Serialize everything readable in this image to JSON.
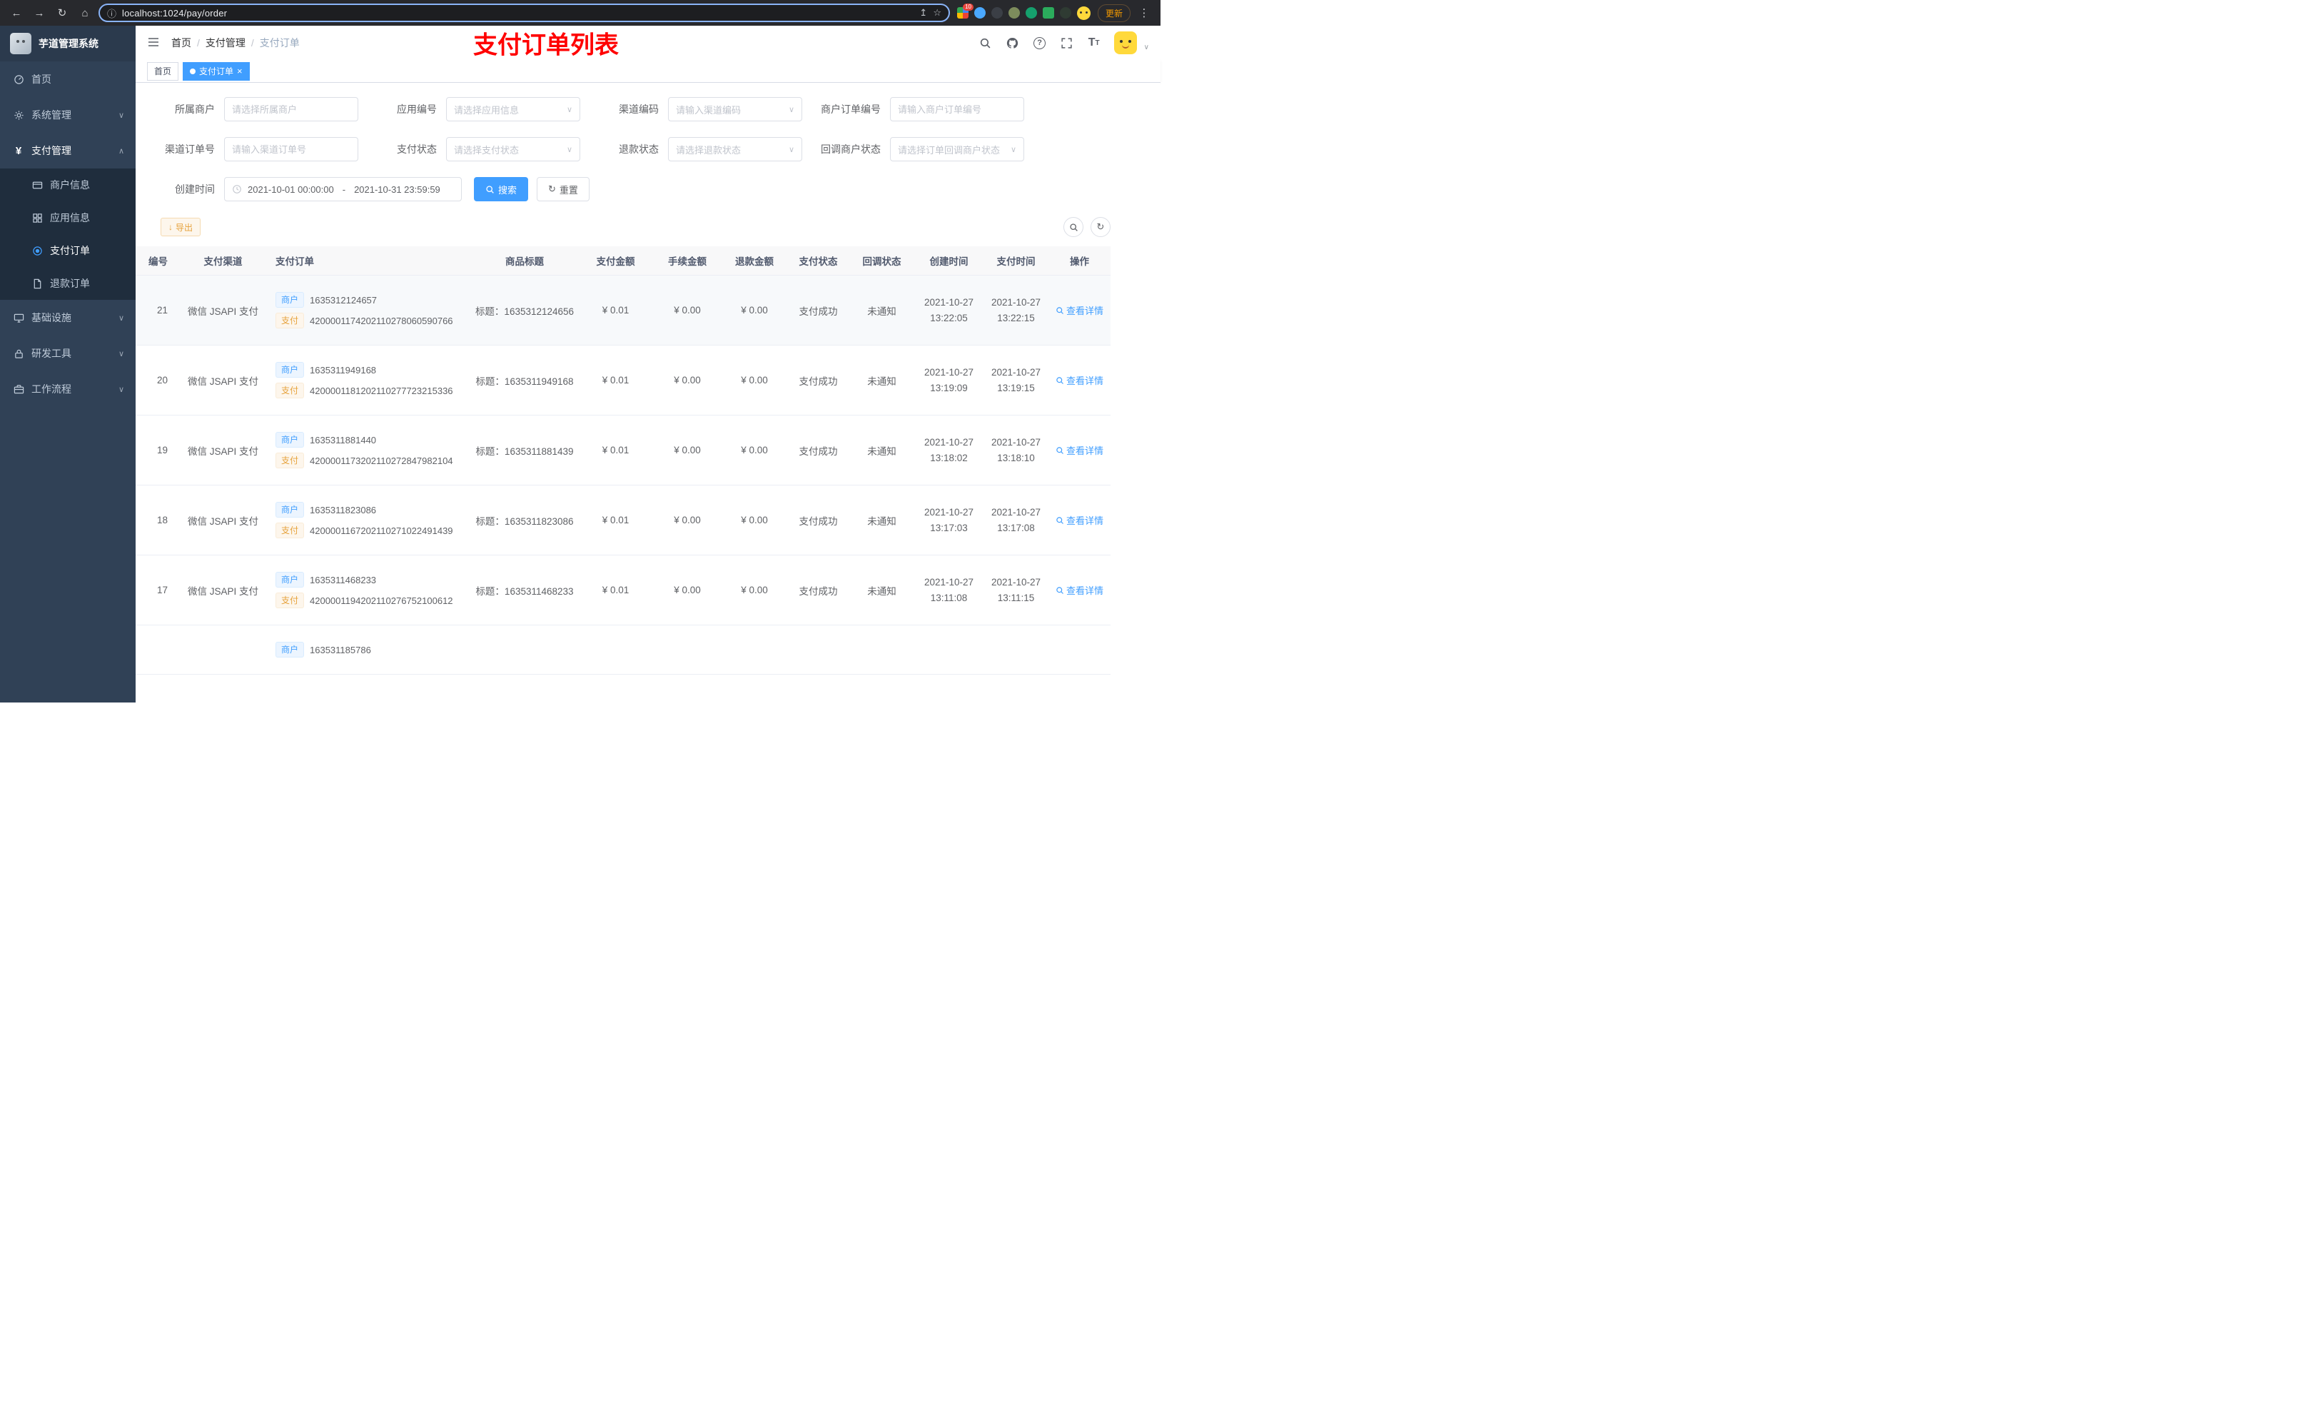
{
  "theme": {
    "accent": "#409eff",
    "annotation_red": "#ff0000",
    "warning": "#e6a23c",
    "sidebar_bg": "#304156"
  },
  "ui_icons": {
    "caret_down": "∨",
    "caret_up": "∧",
    "refresh": "↻",
    "download": "↓",
    "close": "×",
    "question": "?",
    "fontsize": "T",
    "avatar_caret": "∨"
  },
  "browser": {
    "url": "localhost:1024/pay/order",
    "update_label": "更新",
    "extension_badge": "10",
    "icons": {
      "back": "←",
      "forward": "→",
      "reload": "↻",
      "home": "⌂",
      "info": "ⓘ",
      "share": "↥",
      "star": "☆",
      "menu": "⋮"
    }
  },
  "sidebar": {
    "title": "芋道管理系统",
    "menu": [
      {
        "label": "首页"
      },
      {
        "label": "系统管理"
      },
      {
        "label": "支付管理"
      },
      {
        "label": "基础设施"
      },
      {
        "label": "研发工具"
      },
      {
        "label": "工作流程"
      }
    ],
    "submenu": [
      {
        "label": "商户信息"
      },
      {
        "label": "应用信息"
      },
      {
        "label": "支付订单"
      },
      {
        "label": "退款订单"
      }
    ]
  },
  "header": {
    "breadcrumb": [
      "首页",
      "支付管理",
      "支付订单"
    ],
    "annotation": "支付订单列表"
  },
  "tabs": [
    {
      "label": "首页"
    },
    {
      "label": "支付订单"
    }
  ],
  "filters": {
    "fields": [
      {
        "label": "所属商户",
        "placeholder": "请选择所属商户"
      },
      {
        "label": "应用编号",
        "placeholder": "请选择应用信息"
      },
      {
        "label": "渠道编码",
        "placeholder": "请输入渠道编码"
      },
      {
        "label": "商户订单编号",
        "placeholder": "请输入商户订单编号"
      },
      {
        "label": "渠道订单号",
        "placeholder": "请输入渠道订单号"
      },
      {
        "label": "支付状态",
        "placeholder": "请选择支付状态"
      },
      {
        "label": "退款状态",
        "placeholder": "请选择退款状态"
      },
      {
        "label": "回调商户状态",
        "placeholder": "请选择订单回调商户状态"
      }
    ],
    "date_label": "创建时间",
    "date_start": "2021-10-01 00:00:00",
    "date_separator": "-",
    "date_end": "2021-10-31 23:59:59",
    "search_label": "搜索",
    "reset_label": "重置"
  },
  "toolbar": {
    "export_label": "导出"
  },
  "table": {
    "columns": [
      "编号",
      "支付渠道",
      "支付订单",
      "商品标题",
      "支付金额",
      "手续金额",
      "退款金额",
      "支付状态",
      "回调状态",
      "创建时间",
      "支付时间",
      "操作"
    ],
    "merchant_tag_label": "商户",
    "pay_tag_label": "支付",
    "action_label": "查看详情",
    "rows": [
      {
        "id": "21",
        "channel": "微信 JSAPI 支付",
        "merchant_no": "1635312124657",
        "pay_no": "4200001174202110278060590766",
        "title": "标题：1635312124656",
        "amount": "¥ 0.01",
        "fee": "¥ 0.00",
        "refund": "¥ 0.00",
        "status": "支付成功",
        "notify": "未通知",
        "create_date": "2021-10-27",
        "create_time": "13:22:05",
        "pay_date": "2021-10-27",
        "pay_time": "13:22:15"
      },
      {
        "id": "20",
        "channel": "微信 JSAPI 支付",
        "merchant_no": "1635311949168",
        "pay_no": "4200001181202110277723215336",
        "title": "标题：1635311949168",
        "amount": "¥ 0.01",
        "fee": "¥ 0.00",
        "refund": "¥ 0.00",
        "status": "支付成功",
        "notify": "未通知",
        "create_date": "2021-10-27",
        "create_time": "13:19:09",
        "pay_date": "2021-10-27",
        "pay_time": "13:19:15"
      },
      {
        "id": "19",
        "channel": "微信 JSAPI 支付",
        "merchant_no": "1635311881440",
        "pay_no": "4200001173202110272847982104",
        "title": "标题：1635311881439",
        "amount": "¥ 0.01",
        "fee": "¥ 0.00",
        "refund": "¥ 0.00",
        "status": "支付成功",
        "notify": "未通知",
        "create_date": "2021-10-27",
        "create_time": "13:18:02",
        "pay_date": "2021-10-27",
        "pay_time": "13:18:10"
      },
      {
        "id": "18",
        "channel": "微信 JSAPI 支付",
        "merchant_no": "1635311823086",
        "pay_no": "4200001167202110271022491439",
        "title": "标题：1635311823086",
        "amount": "¥ 0.01",
        "fee": "¥ 0.00",
        "refund": "¥ 0.00",
        "status": "支付成功",
        "notify": "未通知",
        "create_date": "2021-10-27",
        "create_time": "13:17:03",
        "pay_date": "2021-10-27",
        "pay_time": "13:17:08"
      },
      {
        "id": "17",
        "channel": "微信 JSAPI 支付",
        "merchant_no": "1635311468233",
        "pay_no": "4200001194202110276752100612",
        "title": "标题：1635311468233",
        "amount": "¥ 0.01",
        "fee": "¥ 0.00",
        "refund": "¥ 0.00",
        "status": "支付成功",
        "notify": "未通知",
        "create_date": "2021-10-27",
        "create_time": "13:11:08",
        "pay_date": "2021-10-27",
        "pay_time": "13:11:15"
      }
    ],
    "partial_row": {
      "merchant_no": "163531185786"
    }
  }
}
